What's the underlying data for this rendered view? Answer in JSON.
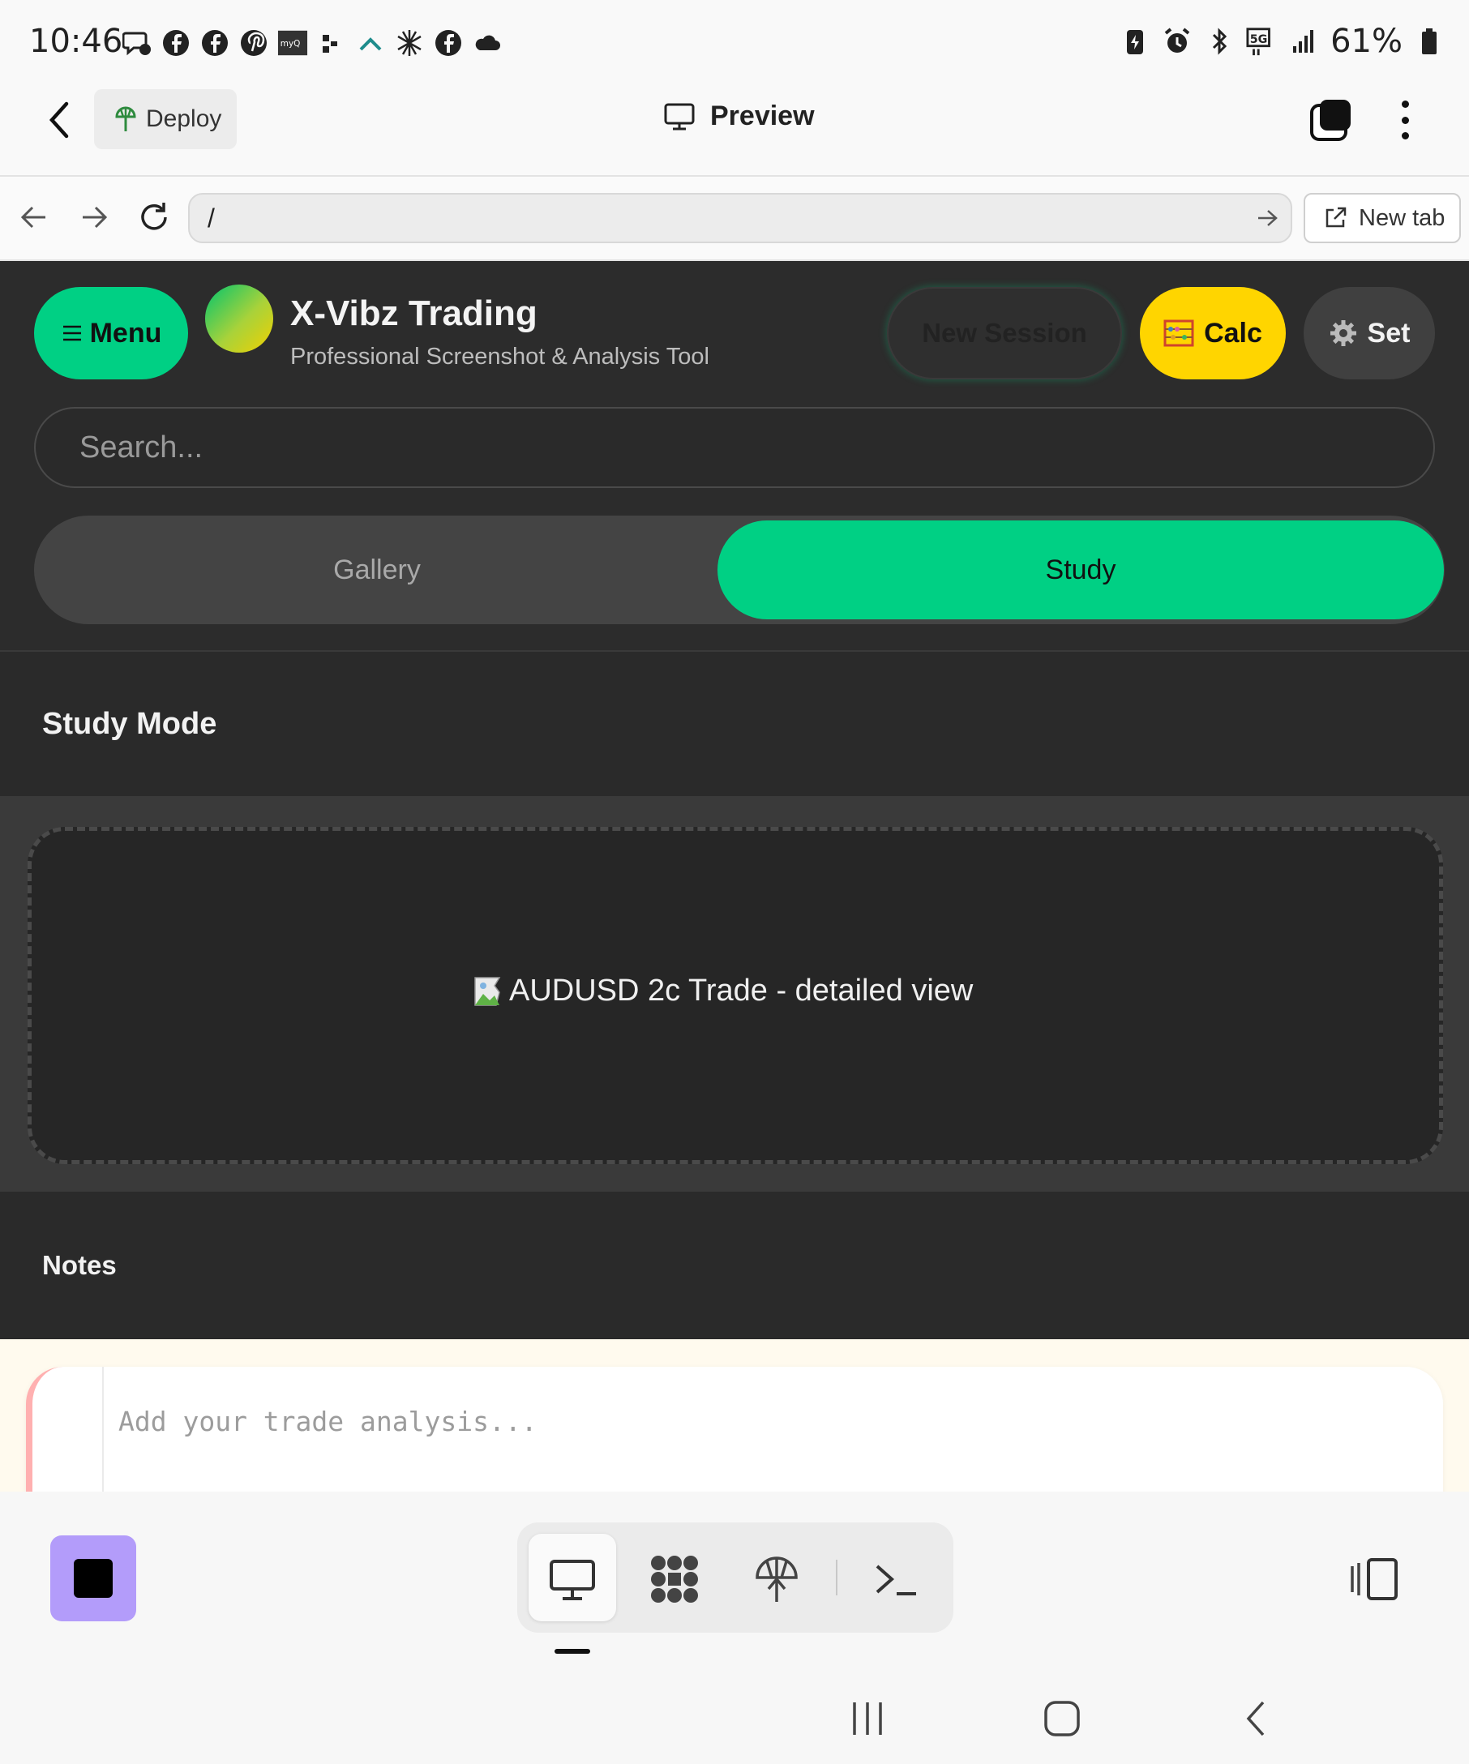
{
  "status_bar": {
    "time": "10:46",
    "battery_text": "61%",
    "left_icons": [
      "messages-icon",
      "facebook-icon",
      "facebook-icon",
      "pinterest-icon",
      "myq-icon",
      "slack-icon",
      "app-icon",
      "network-icon",
      "facebook-icon",
      "cloud-icon"
    ],
    "right_icons": [
      "battery-saver-icon",
      "alarm-icon",
      "bluetooth-icon",
      "5g-icon",
      "signal-icon",
      "battery-icon"
    ]
  },
  "app_bar": {
    "deploy_label": "Deploy",
    "preview_label": "Preview"
  },
  "browser": {
    "url": "/",
    "new_tab_label": "New tab"
  },
  "webapp": {
    "menu_label": "Menu",
    "title": "X-Vibz Trading",
    "subtitle": "Professional Screenshot & Analysis Tool",
    "new_session_label": "New Session",
    "calc_label": "Calc",
    "set_label": "Set",
    "search_placeholder": "Search...",
    "tabs": [
      {
        "label": "Gallery",
        "active": false
      },
      {
        "label": "Study",
        "active": true
      }
    ],
    "study_mode_title": "Study Mode",
    "image_alt": "AUDUSD 2c Trade - detailed view",
    "notes_title": "Notes",
    "notes_placeholder": "Add your trade analysis...",
    "colors": {
      "accent_green": "#00d084",
      "accent_yellow": "#ffd500",
      "background": "#2a2a2a"
    }
  },
  "bottom_toolbar": {
    "tools": [
      "preview-icon",
      "apps-icon",
      "deploy-icon",
      "terminal-icon"
    ],
    "stop_color": "#b39cfa"
  }
}
